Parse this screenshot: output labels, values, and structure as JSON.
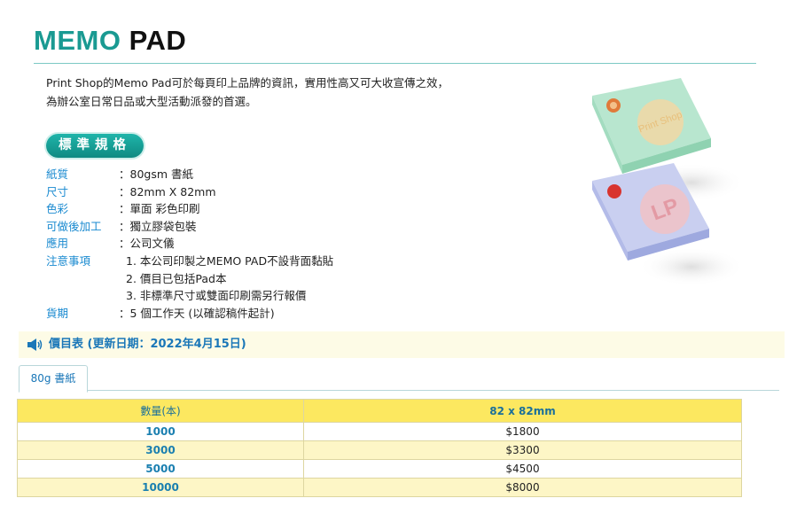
{
  "page": {
    "title_part1": "MEMO",
    "title_part2": "PAD",
    "intro_line1": "Print Shop的Memo Pad可於每頁印上品牌的資訊，實用性高又可大收宣傳之效，",
    "intro_line2": "為辦公室日常日品或大型活動派發的首選。"
  },
  "specs": {
    "badge": "標準規格",
    "rows": [
      {
        "label": "紙質",
        "value": "：80gsm 書紙"
      },
      {
        "label": "尺寸",
        "value": "：82mm X 82mm"
      },
      {
        "label": "色彩",
        "value": "：單面 彩色印刷"
      },
      {
        "label": "可做後加工",
        "value": "：獨立膠袋包裝"
      },
      {
        "label": "應用",
        "value": "：公司文儀"
      },
      {
        "label": "注意事項",
        "value": "1. 本公司印製之MEMO PAD不設背面黏貼"
      },
      {
        "label": "",
        "value": "2. 價目已包括Pad本"
      },
      {
        "label": "",
        "value": "3. 非標準尺寸或雙面印刷需另行報價"
      },
      {
        "label": "貨期",
        "value": "：5 個工作天 (以確認稿件起計)"
      }
    ]
  },
  "price_header": "價目表 (更新日期：2022年4月15日)",
  "tab": {
    "label": "80g 書紙"
  },
  "table": {
    "headers": [
      "數量(本)",
      "82 x 82mm"
    ],
    "rows": [
      {
        "qty": "1000",
        "price": "$1800"
      },
      {
        "qty": "3000",
        "price": "$3300"
      },
      {
        "qty": "5000",
        "price": "$4500"
      },
      {
        "qty": "10000",
        "price": "$8000"
      }
    ]
  },
  "illustration": {
    "pad1_text": "Print Shop",
    "pad2_text": "LP"
  },
  "colors": {
    "accent": "#1a9a92",
    "label_blue": "#1a8ad0",
    "table_header": "#fce860",
    "table_alt": "#fdf6c6"
  }
}
